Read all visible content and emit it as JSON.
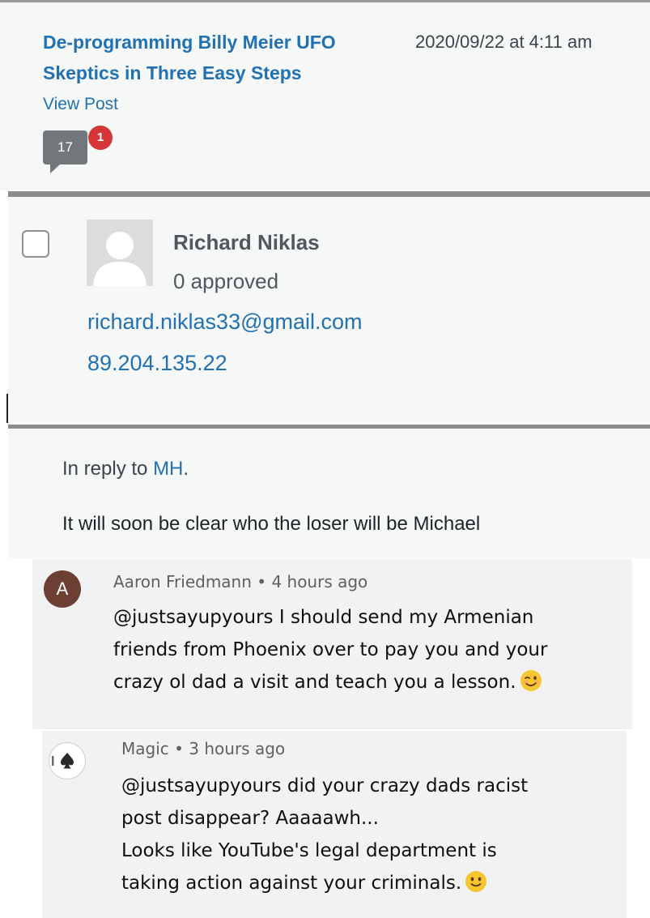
{
  "post": {
    "title": "De-programming Billy Meier UFO Skeptics in Three Easy Steps",
    "date": "2020/09/22 at 4:11 am",
    "view_post": "View Post",
    "comment_count": "17",
    "pending_count": "1"
  },
  "author": {
    "name": "Richard Niklas",
    "approved": "0 approved",
    "email": "richard.niklas33@gmail.com",
    "ip": "89.204.135.22"
  },
  "reply": {
    "prefix": "In reply to ",
    "to": "MH",
    "suffix": ".",
    "body": "It will soon be clear who the loser will be Michael"
  },
  "youtube_comments": [
    {
      "avatar_letter": "A",
      "author": "Aaron Friedmann",
      "time": "4 hours ago",
      "separator": " • ",
      "lines": [
        "@justsayupyours I should send my Armenian",
        "friends from Phoenix over to pay you and your",
        "crazy ol dad a visit and teach you a lesson."
      ],
      "emoji": "winking-face-icon"
    },
    {
      "author": "Magic",
      "time": "3 hours ago",
      "separator": " • ",
      "lines": [
        "@justsayupyours did your crazy dads racist",
        "post disappear? Aaaaawh...",
        "Looks like YouTube's legal department is",
        "taking action against your criminals."
      ],
      "emoji": "slightly-smiling-face-icon"
    }
  ],
  "colors": {
    "link": "#2271b1",
    "badge": "#d63638",
    "bubble": "#72777c",
    "avatar_a": "#6d3f32",
    "emoji": "#f7c531"
  }
}
